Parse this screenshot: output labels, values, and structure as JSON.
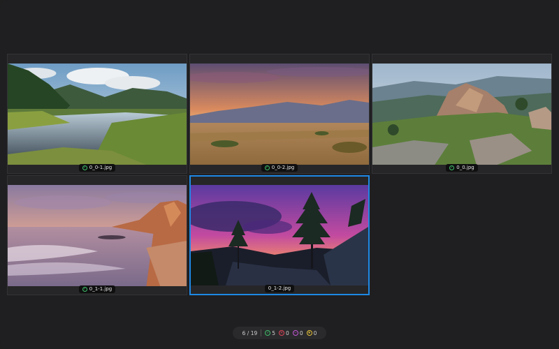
{
  "gallery": {
    "items": [
      {
        "filename": "0_0-1.jpg",
        "status": "accepted",
        "scene": "lake-reflection"
      },
      {
        "filename": "0_0-2.jpg",
        "status": "accepted",
        "scene": "prairie-sunset"
      },
      {
        "filename": "0_0.jpg",
        "status": "accepted",
        "scene": "mountain-rocks"
      },
      {
        "filename": "0_1-1.jpg",
        "status": "accepted",
        "scene": "beach-cliffs"
      },
      {
        "filename": "0_1-2.jpg",
        "status": "none",
        "scene": "pine-dusk",
        "selected": true
      }
    ]
  },
  "statusbar": {
    "position": "6 / 19",
    "accepted_count": "5",
    "rejected_count": "0",
    "minus_count": "0",
    "star_count": "0"
  },
  "colors": {
    "accent": "#1e88e5",
    "accepted": "#3fbf6a",
    "rejected": "#e0455a",
    "minus": "#c455d8",
    "star": "#e6c23a"
  }
}
